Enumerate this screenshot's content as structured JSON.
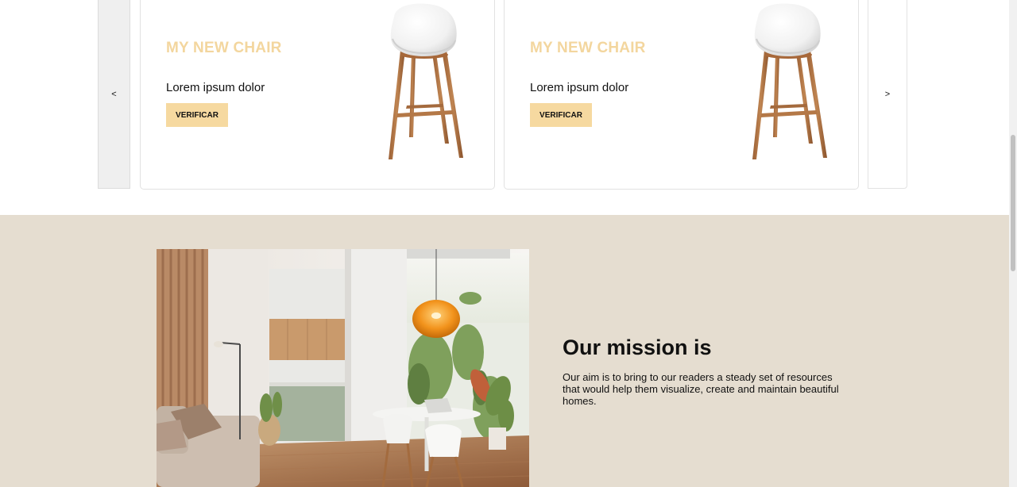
{
  "carousel": {
    "prev_label": "<",
    "next_label": ">",
    "cards": [
      {
        "title": "MY NEW CHAIR",
        "description": "Lorem ipsum dolor",
        "button_label": "VERIFICAR",
        "image_icon": "stool-chair-image"
      },
      {
        "title": "MY NEW CHAIR",
        "description": "Lorem ipsum dolor",
        "button_label": "VERIFICAR",
        "image_icon": "stool-chair-image"
      }
    ]
  },
  "mission": {
    "title": "Our mission is",
    "text": "Our aim is to bring to our readers a steady set of resources that would help them visualize, create and maintain beautiful homes.",
    "image": "interior-room-photo"
  },
  "colors": {
    "accent": "#f6d9a0",
    "title_accent": "#f3d69e",
    "section_bg": "#e5ddd0"
  }
}
